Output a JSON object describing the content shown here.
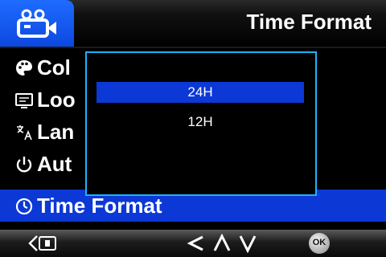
{
  "header": {
    "title": "Time Format",
    "mode_icon": "video-camera-icon"
  },
  "menu": {
    "items": [
      {
        "label": "Col",
        "icon": "palette-icon"
      },
      {
        "label": "Loo",
        "icon": "screen-icon"
      },
      {
        "label": "Lan",
        "icon": "language-icon"
      },
      {
        "label": "Aut",
        "icon": "power-icon"
      },
      {
        "label": "Time Format",
        "icon": "clock-icon"
      }
    ],
    "selected_index": 4
  },
  "dialog": {
    "options": [
      {
        "label": "24H"
      },
      {
        "label": "12H"
      }
    ],
    "selected_index": 0
  },
  "footer": {
    "back_icon": "back-icon",
    "left_icon": "chevron-left-icon",
    "up_icon": "chevron-up-icon",
    "down_icon": "chevron-down-icon",
    "ok_label": "OK"
  },
  "colors": {
    "accent": "#0c38d6",
    "dialog_border": "#19b5ff"
  }
}
